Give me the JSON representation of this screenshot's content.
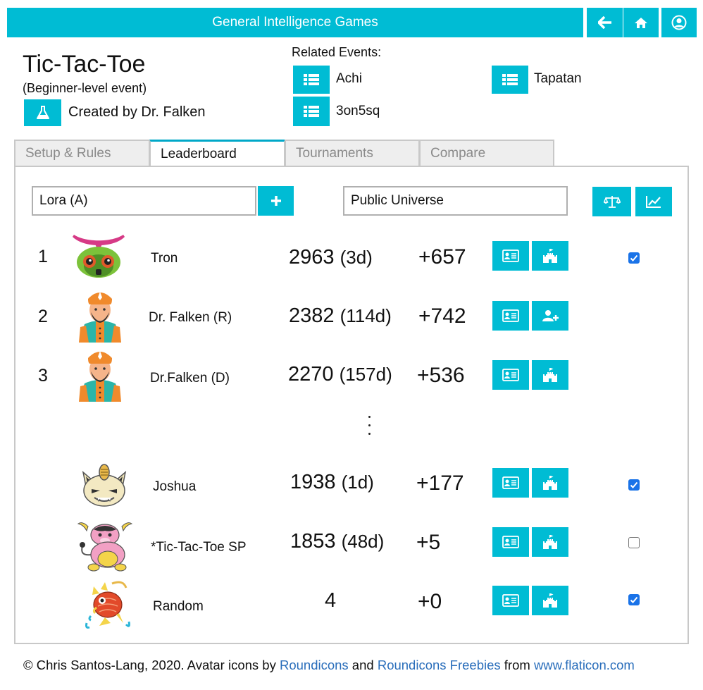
{
  "header": {
    "title": "General Intelligence Games",
    "buttons": [
      "back-arrow-icon",
      "home-icon",
      "user-circle-icon"
    ]
  },
  "event": {
    "title": "Tic-Tac-Toe",
    "subtitle": "(Beginner-level event)",
    "creator": "Created by Dr. Falken",
    "creator_icon": "flask-icon"
  },
  "related": {
    "label": "Related Events:",
    "items": [
      {
        "label": "Achi"
      },
      {
        "label": "Tapatan"
      },
      {
        "label": "3on5sq"
      }
    ]
  },
  "tabs": [
    {
      "label": "Setup & Rules",
      "active": false
    },
    {
      "label": "Leaderboard",
      "active": true
    },
    {
      "label": "Tournaments",
      "active": false
    },
    {
      "label": "Compare",
      "active": false
    }
  ],
  "controls": {
    "player_field": "Lora (A)",
    "universe_field": "Public Universe",
    "add_icon": "plus-icon",
    "compare_icon": "balance-scale-icon",
    "chart_icon": "line-chart-icon"
  },
  "leaderboard": [
    {
      "rank": "1",
      "name": "Tron",
      "rating": "2963",
      "age": "(3d)",
      "delta": "+657",
      "avatar": "masked-creature-avatar",
      "action_icon": "castle-icon",
      "checked": true
    },
    {
      "rank": "2",
      "name": "Dr. Falken (R)",
      "rating": "2382",
      "age": "(114d)",
      "delta": "+742",
      "avatar": "bearded-man-avatar",
      "action_icon": "add-user-icon",
      "checked": null
    },
    {
      "rank": "3",
      "name": "Dr.Falken (D)",
      "rating": "2270",
      "age": "(157d)",
      "delta": "+536",
      "avatar": "bearded-man-avatar",
      "action_icon": "castle-icon",
      "checked": null
    },
    {
      "rank": "",
      "name": "Joshua",
      "rating": "1938",
      "age": "(1d)",
      "delta": "+177",
      "avatar": "cat-avatar",
      "action_icon": "castle-icon",
      "checked": true
    },
    {
      "rank": "",
      "name": "*Tic-Tac-Toe SP",
      "rating": "1853",
      "age": "(48d)",
      "delta": "+5",
      "avatar": "pink-cow-avatar",
      "action_icon": "castle-icon",
      "checked": false
    },
    {
      "rank": "",
      "name": "Random",
      "rating": "4",
      "age": "",
      "delta": "+0",
      "avatar": "red-fish-avatar",
      "action_icon": "castle-icon",
      "checked": true
    }
  ],
  "footer": {
    "prefix": "© Chris Santos-Lang, 2020. Avatar icons by ",
    "link1": "Roundicons",
    "and": " and ",
    "link2": "Roundicons Freebies",
    "from": " from ",
    "link3": "www.flaticon.com"
  },
  "colors": {
    "accent": "#00bcd4",
    "link": "#2a6ebb",
    "checkbox": "#1a73e8"
  }
}
